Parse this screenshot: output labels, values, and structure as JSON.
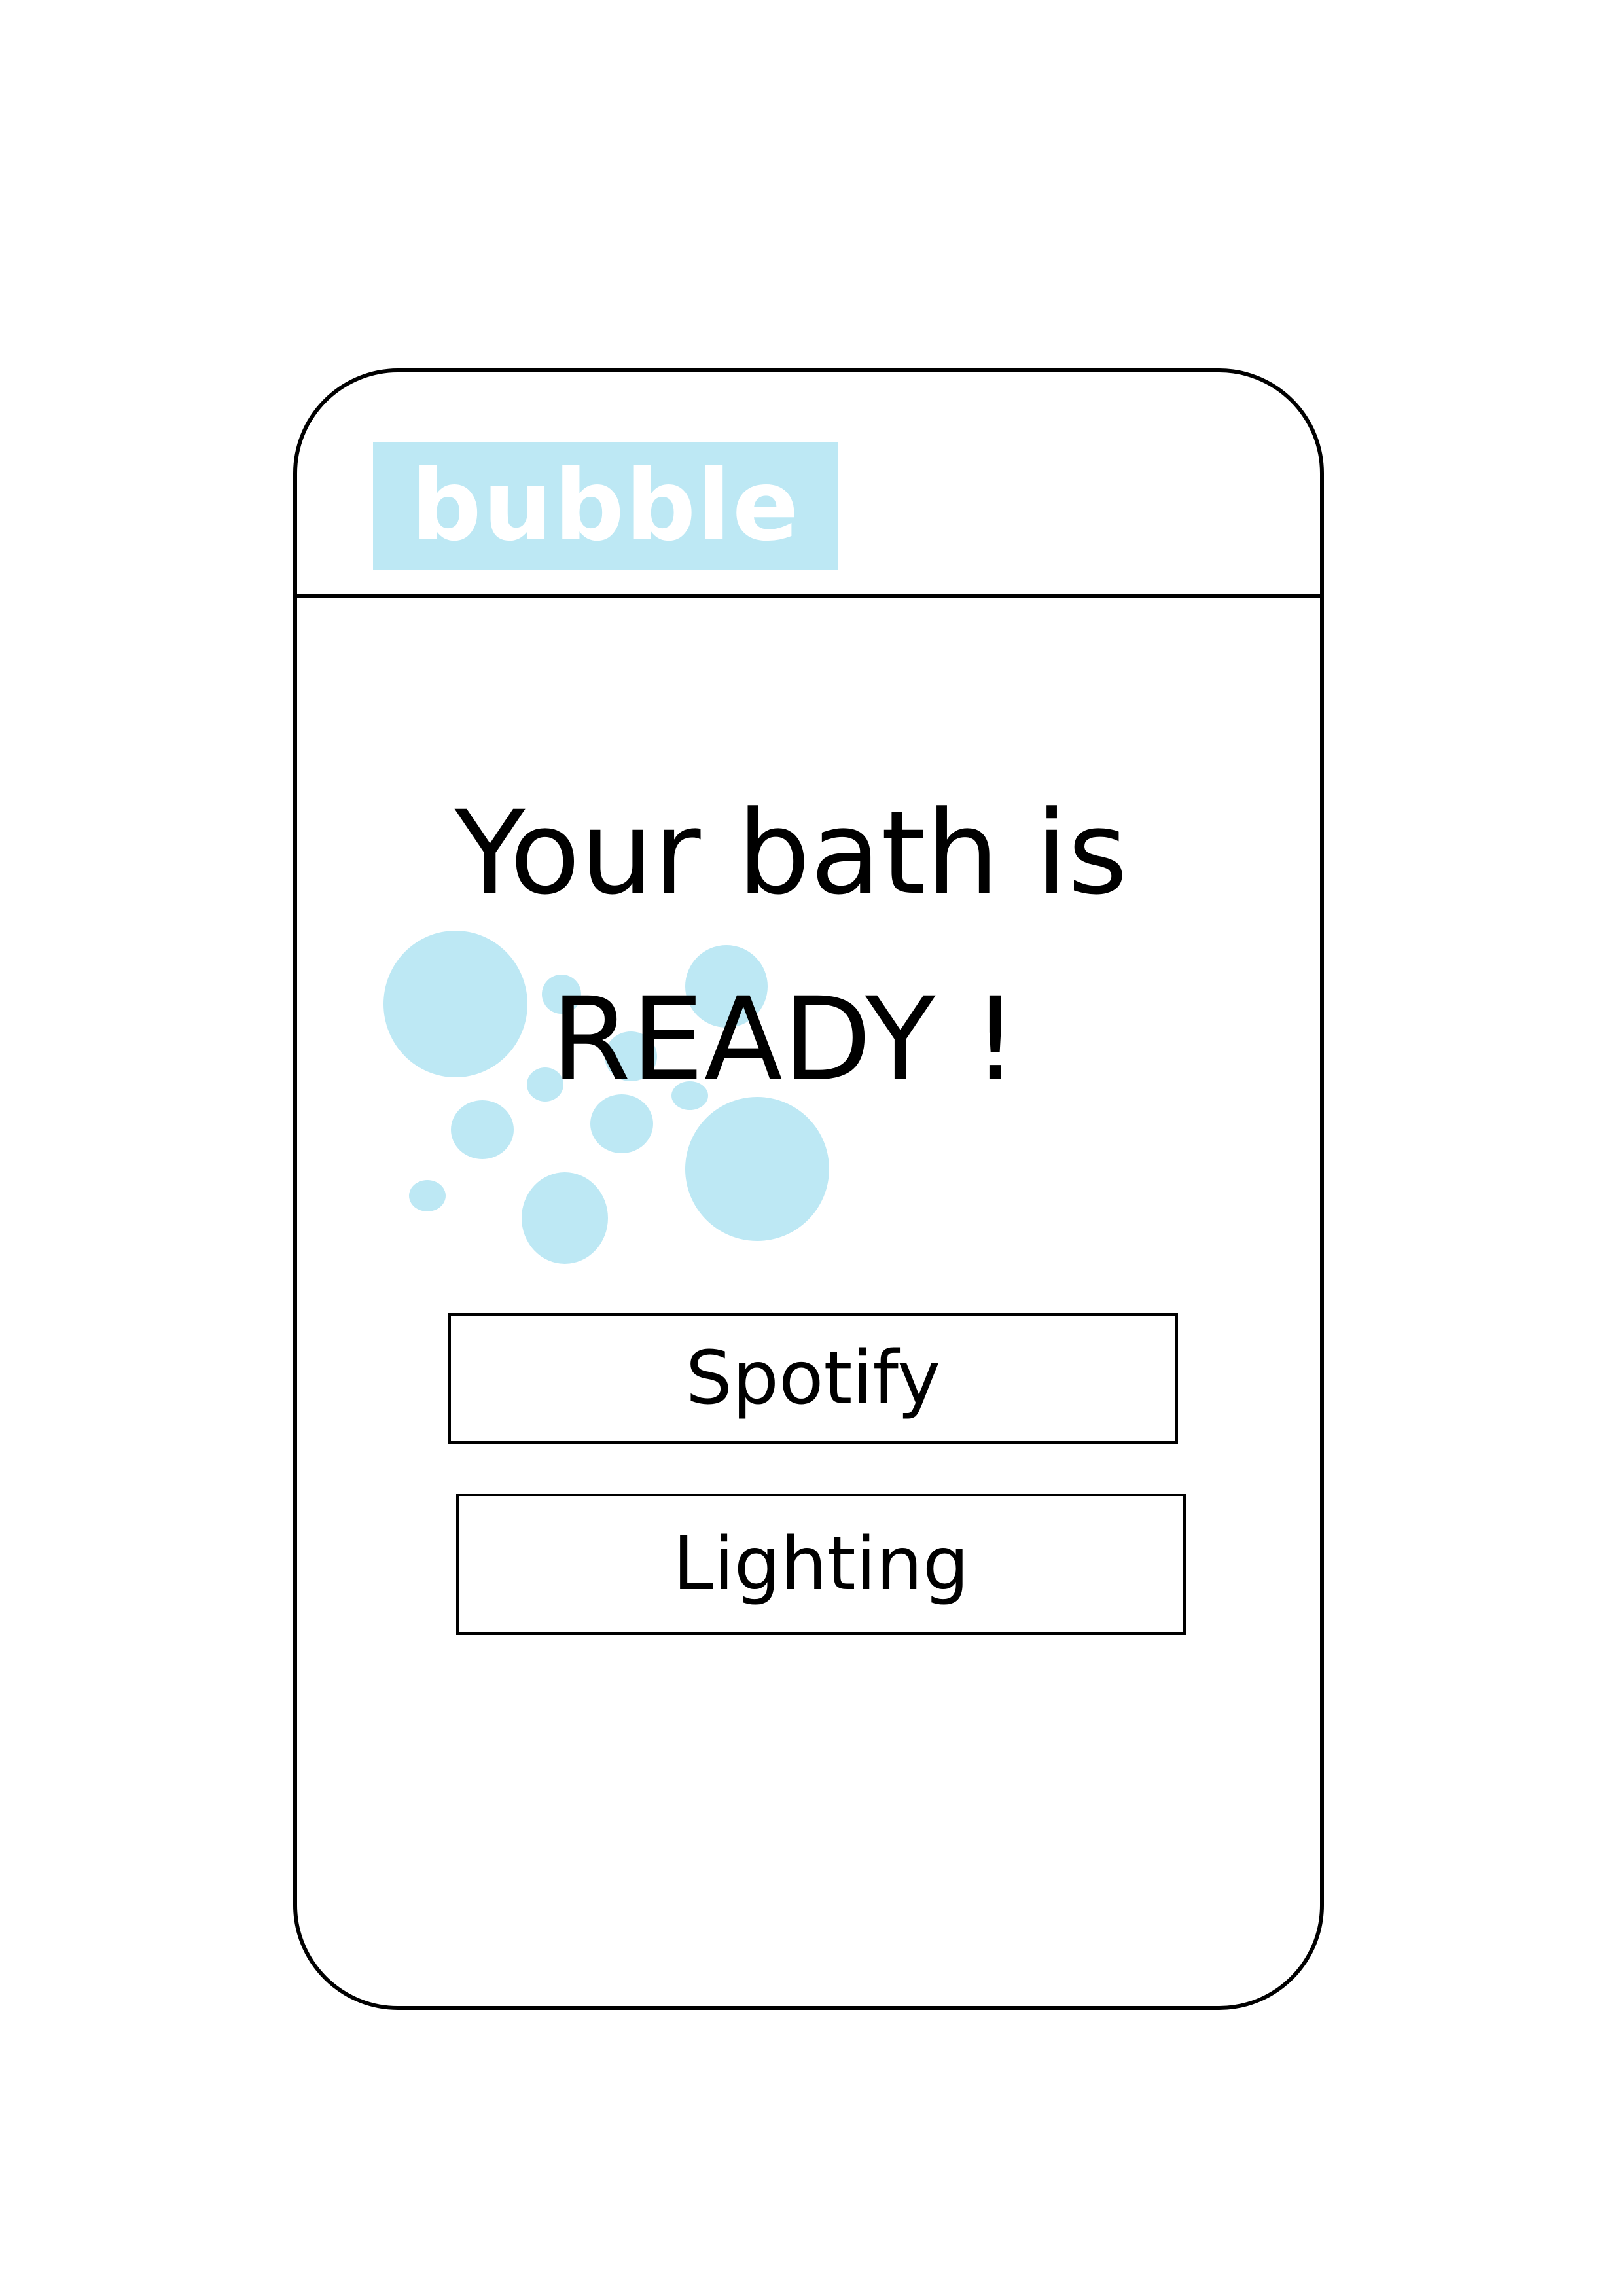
{
  "app": {
    "logo_text": "bubble"
  },
  "main": {
    "headline_line1": "Your bath is",
    "headline_line2": "READY !"
  },
  "actions": {
    "spotify_label": "Spotify",
    "lighting_label": "Lighting"
  },
  "colors": {
    "bubble_blue": "#bde8f4",
    "outline": "#000000",
    "background": "#ffffff"
  }
}
